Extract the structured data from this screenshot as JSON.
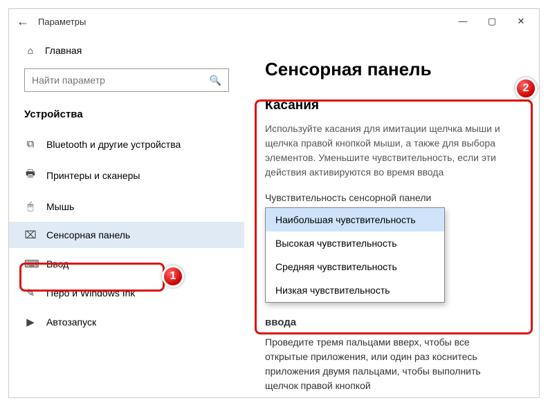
{
  "window": {
    "title": "Параметры"
  },
  "sidebar": {
    "home_label": "Главная",
    "search_placeholder": "Найти параметр",
    "group_label": "Устройства",
    "items": [
      {
        "icon": "bluetooth-icon",
        "label": "Bluetooth и другие устройства"
      },
      {
        "icon": "printer-icon",
        "label": "Принтеры и сканеры"
      },
      {
        "icon": "mouse-icon",
        "label": "Мышь"
      },
      {
        "icon": "touchpad-icon",
        "label": "Сенсорная панель",
        "active": true
      },
      {
        "icon": "keyboard-icon",
        "label": "Ввод"
      },
      {
        "icon": "pen-icon",
        "label": "Перо и Windows Ink"
      },
      {
        "icon": "autoplay-icon",
        "label": "Автозапуск"
      }
    ]
  },
  "content": {
    "page_title": "Сенсорная панель",
    "section_title": "Касания",
    "description": "Используйте касания для имитации щелчка мыши и щелчка правой кнопкой мыши, а также для выбора элементов. Уменьшите чувствительность, если эти действия активируются во время ввода",
    "dropdown_label": "Чувствительность сенсорной панели",
    "options": [
      "Наибольшая чувствительность",
      "Высокая чувствительность",
      "Средняя чувствительность",
      "Низкая чувствительность"
    ],
    "selected_index": 0,
    "below_title": "ввода",
    "below_text": "Проведите тремя пальцами вверх, чтобы все открытые приложения, или один раз коснитесь приложения двумя пальцами, чтобы выполнить щелчок правой кнопкой"
  },
  "annotations": {
    "markers": [
      "1",
      "2"
    ]
  },
  "icons": {
    "back": "←",
    "home": "⌂",
    "search": "🔍",
    "bluetooth": "⧉",
    "printer": "🖶",
    "mouse": "🖱",
    "touchpad": "⌧",
    "keyboard": "⌨",
    "pen": "✎",
    "autoplay": "▶",
    "minimize": "―",
    "maximize": "▢",
    "close": "✕"
  }
}
